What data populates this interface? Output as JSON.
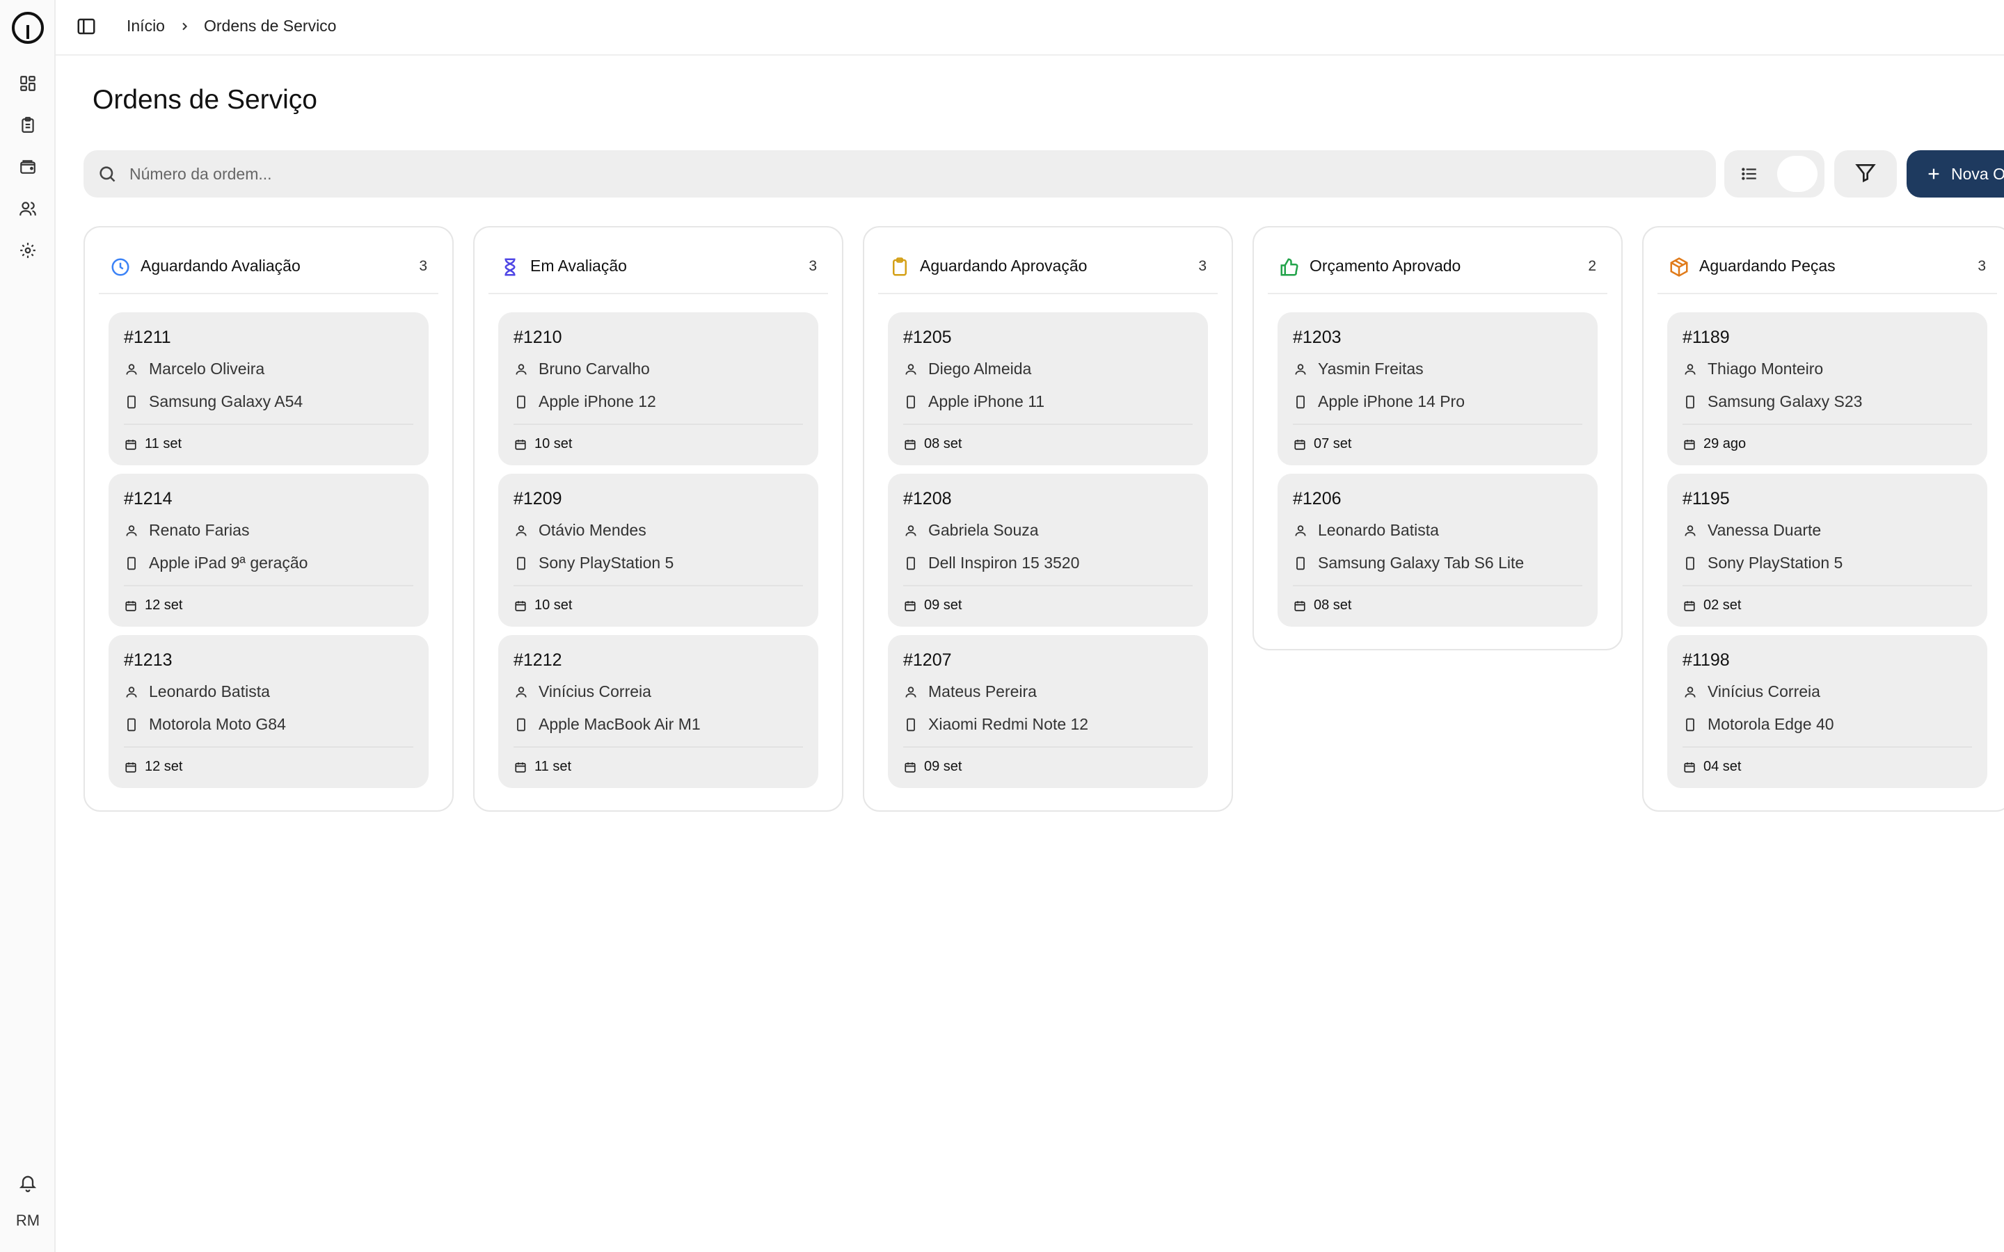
{
  "user": {
    "initials": "RM"
  },
  "breadcrumb": {
    "home": "Início",
    "current": "Ordens de Servico"
  },
  "page": {
    "title": "Ordens de Serviço"
  },
  "search": {
    "placeholder": "Número da ordem..."
  },
  "actions": {
    "new_label": "Nova O"
  },
  "colors": {
    "primary": "#1e3a5f",
    "clock": "#3b82f6",
    "hourglass": "#4f46e5",
    "clipboard": "#d4a017",
    "thumb": "#22a34a",
    "package": "#e07b1a"
  },
  "columns": [
    {
      "icon": "clock-icon",
      "title": "Aguardando Avaliação",
      "count": "3",
      "cards": [
        {
          "number": "#1211",
          "client": "Marcelo Oliveira",
          "device": "Samsung Galaxy A54",
          "date": "11 set"
        },
        {
          "number": "#1214",
          "client": "Renato Farias",
          "device": "Apple iPad 9ª geração",
          "date": "12 set"
        },
        {
          "number": "#1213",
          "client": "Leonardo Batista",
          "device": "Motorola Moto G84",
          "date": "12 set"
        }
      ]
    },
    {
      "icon": "hourglass-icon",
      "title": "Em Avaliação",
      "count": "3",
      "cards": [
        {
          "number": "#1210",
          "client": "Bruno Carvalho",
          "device": "Apple iPhone 12",
          "date": "10 set"
        },
        {
          "number": "#1209",
          "client": "Otávio Mendes",
          "device": "Sony PlayStation 5",
          "date": "10 set"
        },
        {
          "number": "#1212",
          "client": "Vinícius Correia",
          "device": "Apple MacBook Air M1",
          "date": "11 set"
        }
      ]
    },
    {
      "icon": "clipboard-icon",
      "title": "Aguardando Aprovação",
      "count": "3",
      "cards": [
        {
          "number": "#1205",
          "client": "Diego Almeida",
          "device": "Apple iPhone 11",
          "date": "08 set"
        },
        {
          "number": "#1208",
          "client": "Gabriela Souza",
          "device": "Dell Inspiron 15 3520",
          "date": "09 set"
        },
        {
          "number": "#1207",
          "client": "Mateus Pereira",
          "device": "Xiaomi Redmi Note 12",
          "date": "09 set"
        }
      ]
    },
    {
      "icon": "thumbs-up-icon",
      "title": "Orçamento Aprovado",
      "count": "2",
      "cards": [
        {
          "number": "#1203",
          "client": "Yasmin Freitas",
          "device": "Apple iPhone 14 Pro",
          "date": "07 set"
        },
        {
          "number": "#1206",
          "client": "Leonardo Batista",
          "device": "Samsung Galaxy Tab S6 Lite",
          "date": "08 set"
        }
      ]
    },
    {
      "icon": "package-icon",
      "title": "Aguardando Peças",
      "count": "3",
      "cards": [
        {
          "number": "#1189",
          "client": "Thiago Monteiro",
          "device": "Samsung Galaxy S23",
          "date": "29 ago"
        },
        {
          "number": "#1195",
          "client": "Vanessa Duarte",
          "device": "Sony PlayStation 5",
          "date": "02 set"
        },
        {
          "number": "#1198",
          "client": "Vinícius Correia",
          "device": "Motorola Edge 40",
          "date": "04 set"
        }
      ]
    }
  ]
}
